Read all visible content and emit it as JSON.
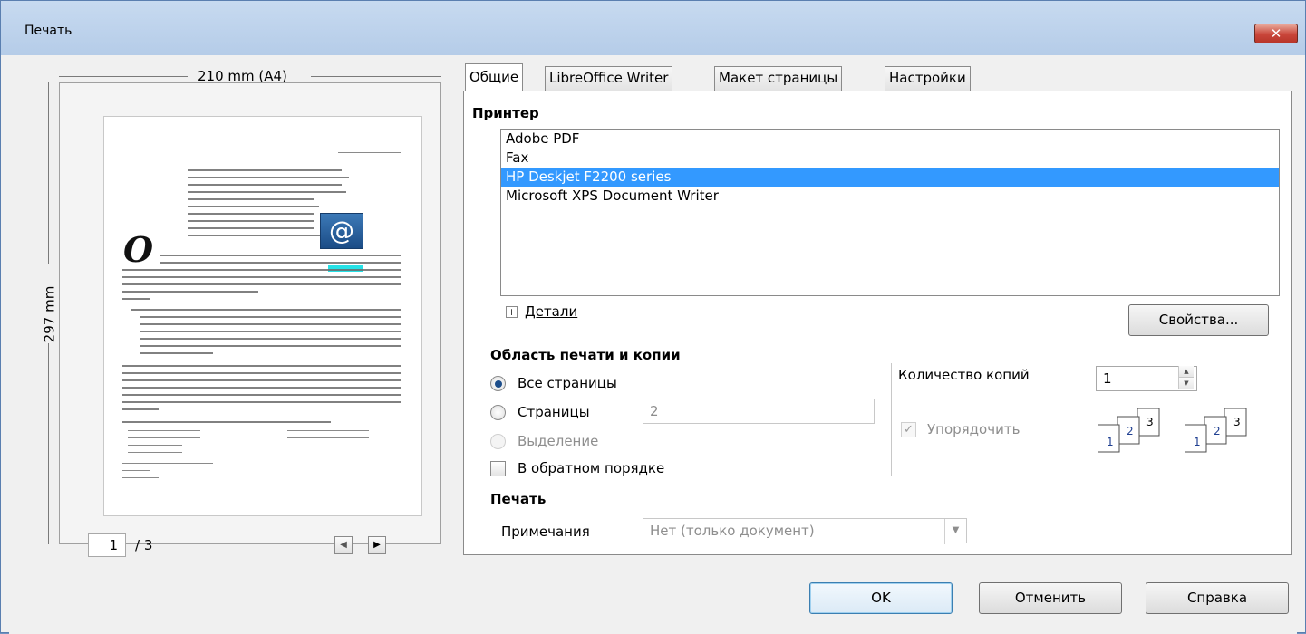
{
  "window": {
    "title": "Печать",
    "close_label": "✕"
  },
  "preview": {
    "width_label": "210 mm (A4)",
    "height_label": "297 mm",
    "current_page": "1",
    "total_pages": "/ 3",
    "prev_icon": "triangle-left",
    "next_icon": "triangle-right"
  },
  "tabs": [
    {
      "label": "Общие",
      "active": true
    },
    {
      "label": "LibreOffice Writer",
      "active": false
    },
    {
      "label": "Макет страницы",
      "active": false
    },
    {
      "label": "Настройки",
      "active": false
    }
  ],
  "printer": {
    "section_title": "Принтер",
    "items": [
      {
        "label": "Adobe PDF",
        "selected": false
      },
      {
        "label": "Fax",
        "selected": false
      },
      {
        "label": "HP Deskjet F2200 series",
        "selected": true
      },
      {
        "label": "Microsoft XPS Document Writer",
        "selected": false
      }
    ],
    "details_label": "Детали",
    "properties_button": "Свойства..."
  },
  "range": {
    "section_title": "Область печати и копии",
    "all_pages_label": "Все страницы",
    "pages_label": "Страницы",
    "pages_value": "2",
    "selection_label": "Выделение",
    "reverse_label": "В обратном порядке",
    "copies_label": "Количество копий",
    "copies_value": "1",
    "collate_label": "Упорядочить",
    "collate_checked": true
  },
  "print_section": {
    "section_title": "Печать",
    "notes_label": "Примечания",
    "notes_value": "Нет (только документ)"
  },
  "footer": {
    "ok_button": "OK",
    "cancel_button": "Отменить",
    "help_button": "Справка"
  },
  "colors": {
    "selection": "#3399ff",
    "title_bar": "#b9cfea",
    "close_button": "#c9463a"
  }
}
